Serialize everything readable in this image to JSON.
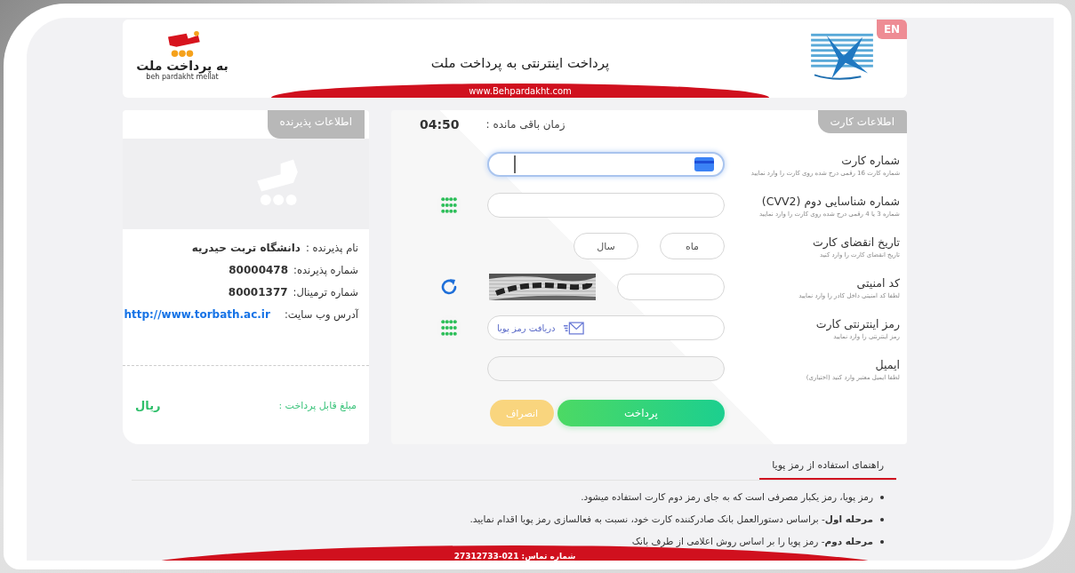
{
  "header": {
    "lang_button": "EN",
    "title": "پرداخت اینترنتی به پرداخت ملت",
    "url": "www.Behpardakht.com",
    "logo_text": "به پرداخت ملت",
    "logo_subtext": "beh pardakht mellat"
  },
  "card_panel": {
    "tab": "اطلاعات کارت",
    "timer_label": "زمان باقی مانده :",
    "timer": "04:50",
    "fields": [
      {
        "kind": "card",
        "label": "شماره کارت",
        "hint": "شماره کارت 16 رقمی درج شده روی کارت را وارد نمایید",
        "focused": true
      },
      {
        "kind": "cvv",
        "label": "شماره شناسایی دوم (CVV2)",
        "hint": "شماره 3 یا 4 رقمی درج شده روی کارت را وارد نمایید",
        "focused": false
      },
      {
        "kind": "expiry",
        "label": "تاریخ انقضای کارت",
        "hint": "تاریخ انقضای کارت را وارد کنید",
        "focused": false,
        "inputs": [
          {
            "placeholder": "ماه"
          },
          {
            "placeholder": "سال"
          }
        ]
      },
      {
        "kind": "captcha",
        "label": "کد امنیتی",
        "hint": "لطفا کد امنیتی داخل کادر را وارد نمایید",
        "focused": false
      },
      {
        "kind": "password",
        "label": "رمز اینترنتی کارت",
        "hint": "رمز اینترنتی را وارد نمایید",
        "focused": false,
        "button": "دریافت رمز پویا"
      },
      {
        "kind": "email",
        "label": "ایمیل",
        "hint": "لطفا ایمیل معتبر وارد کنید (اختیاری)",
        "focused": false
      }
    ],
    "buttons": [
      {
        "kind": "pay",
        "label": "پرداخت"
      },
      {
        "kind": "cancel",
        "label": "انصراف"
      }
    ]
  },
  "merchant_panel": {
    "tab": "اطلاعات پذیرنده",
    "rows": [
      {
        "kind": "text",
        "label": "نام پذیرنده :",
        "value": "دانشگاه تربت حیدریه"
      },
      {
        "kind": "text",
        "label": "شماره پذیرنده:",
        "value": "80000478"
      },
      {
        "kind": "text",
        "label": "شماره ترمینال:",
        "value": "80001377"
      },
      {
        "kind": "link",
        "label": "آدرس وب سایت:",
        "value": "http://www.torbath.ac.ir"
      }
    ],
    "amount_label": "مبلغ قابل پرداخت :",
    "currency": "ریال"
  },
  "guide": {
    "title": "راهنمای استفاده از رمز پویا",
    "items": [
      "رمز پویا، رمز یکبار مصرفی است که به جای رمز دوم کارت استفاده میشود.",
      "**مرحله اول**- براساس دستورالعمل بانک صادرکننده کارت خود، نسبت به فعالسازی رمز پویا اقدام نمایید.",
      "**مرحله دوم**- رمز پویا را بر اساس روش اعلامی از طرف بانک"
    ]
  },
  "footer": {
    "contact": "شماره تماس: 021-27312733"
  }
}
